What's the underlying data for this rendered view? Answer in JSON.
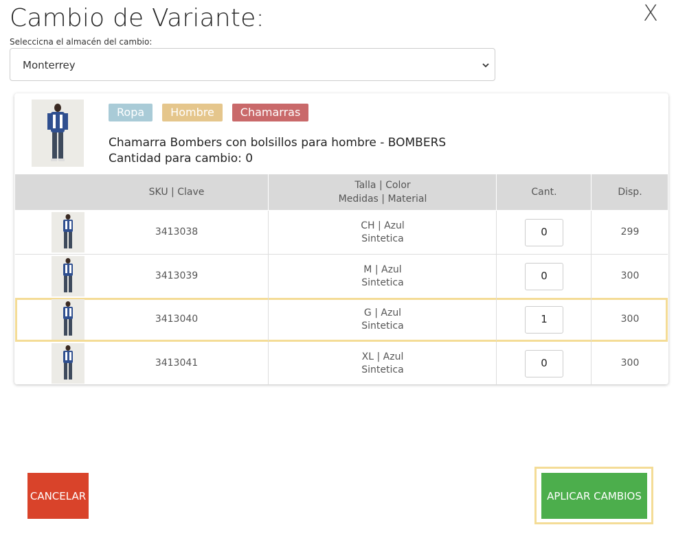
{
  "dialog": {
    "title": "Cambio de Variante:",
    "close_label": "X"
  },
  "warehouse": {
    "label": "Seleccicna el almacén del cambio:",
    "selected": "Monterrey"
  },
  "product": {
    "tags": [
      {
        "label": "Ropa",
        "color": "#a9cbd7"
      },
      {
        "label": "Hombre",
        "color": "#e5c68c"
      },
      {
        "label": "Chamarras",
        "color": "#c9696a"
      }
    ],
    "name": "Chamarra Bombers con bolsillos para hombre - BOMBERS",
    "qty_line": "Cantidad para cambio: 0"
  },
  "table": {
    "headers": {
      "sku": "SKU | Clave",
      "attrs_1": "Talla | Color",
      "attrs_2": "Medidas | Material",
      "qty": "Cant.",
      "avail": "Disp."
    },
    "rows": [
      {
        "sku": "3413038",
        "attr1": "CH | Azul",
        "attr2": "Sintetica",
        "qty": "0",
        "avail": "299"
      },
      {
        "sku": "3413039",
        "attr1": "M | Azul",
        "attr2": "Sintetica",
        "qty": "0",
        "avail": "300"
      },
      {
        "sku": "3413040",
        "attr1": "G | Azul",
        "attr2": "Sintetica",
        "qty": "1",
        "avail": "300"
      },
      {
        "sku": "3413041",
        "attr1": "XL | Azul",
        "attr2": "Sintetica",
        "qty": "0",
        "avail": "300"
      }
    ]
  },
  "actions": {
    "cancel_label": "CANCELAR",
    "apply_label": "APLICAR CAMBIOS"
  },
  "colors": {
    "cancel": "#d9432a",
    "apply": "#4cae4c",
    "highlight": "#f4dc96"
  }
}
